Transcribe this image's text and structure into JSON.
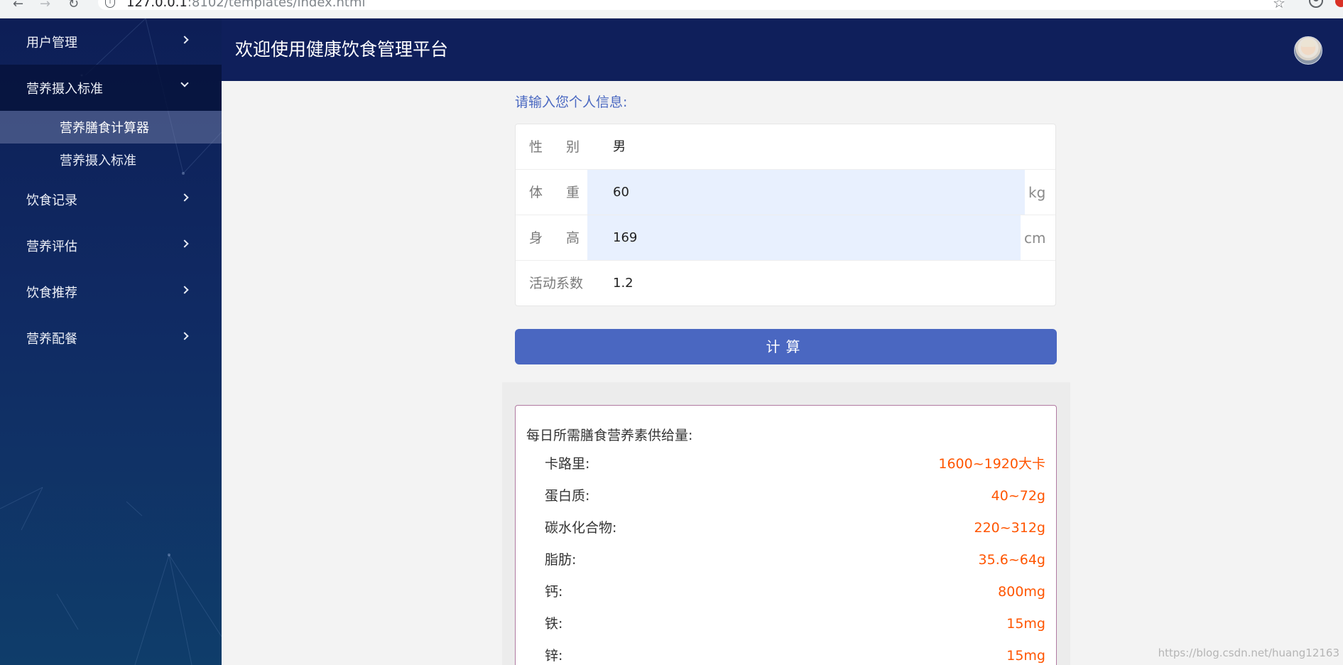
{
  "browser": {
    "url_host": "127.0.0.1",
    "url_rest": ":8102/templates/index.html"
  },
  "sidebar": {
    "items": [
      {
        "label": "用户管理"
      },
      {
        "label": "营养摄入标准",
        "expanded": true,
        "children": [
          {
            "label": "营养膳食计算器",
            "active": true
          },
          {
            "label": "营养摄入标准"
          }
        ]
      },
      {
        "label": "饮食记录"
      },
      {
        "label": "营养评估"
      },
      {
        "label": "饮食推荐"
      },
      {
        "label": "营养配餐"
      }
    ]
  },
  "header": {
    "title": "欢迎使用健康饮食管理平台"
  },
  "form": {
    "prompt": "请输入您个人信息:",
    "gender": {
      "label": "性别",
      "value": "男"
    },
    "weight": {
      "label": "体重",
      "value": "60",
      "unit": "kg"
    },
    "height": {
      "label": "身高",
      "value": "169",
      "unit": "cm"
    },
    "activity": {
      "label": "活动系数",
      "value": "1.2"
    },
    "submit_label": "计算"
  },
  "result": {
    "heading": "每日所需膳食营养素供给量:",
    "rows": [
      {
        "label": "卡路里:",
        "value": "1600~1920大卡"
      },
      {
        "label": "蛋白质:",
        "value": "40~72g"
      },
      {
        "label": "碳水化合物:",
        "value": "220~312g"
      },
      {
        "label": "脂肪:",
        "value": "35.6~64g"
      },
      {
        "label": "钙:",
        "value": "800mg"
      },
      {
        "label": "铁:",
        "value": "15mg"
      },
      {
        "label": "锌:",
        "value": "15mg"
      }
    ]
  },
  "watermark": "https://blog.csdn.net/huang12163",
  "colors": {
    "sidebar": "#0d1e56",
    "header": "#0f1f5b",
    "accent": "#4a67c1",
    "value": "#ff5500"
  }
}
